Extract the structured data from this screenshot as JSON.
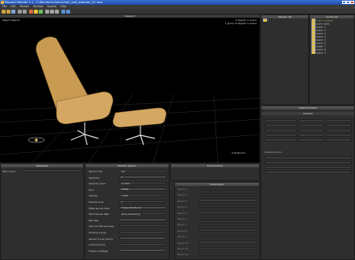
{
  "window": {
    "title": "Maxwell Render 1.1 - C:\\Renders\\chairs\\chair_and_ottoman_01.mxs"
  },
  "menu": [
    "File",
    "Edit",
    "Render",
    "Window",
    "Special",
    "Help"
  ],
  "viewport": {
    "label": "Object objects",
    "header": "Viewport",
    "info_line1": "0 objects in scene",
    "info_line2": "1 group of objects in scene",
    "fps": "0.00 fps 0%"
  },
  "objects_panel": {
    "header": "Objects list"
  },
  "scene_panel": {
    "header": "Scene list",
    "items": [
      "scene_camera",
      "scene_light",
      "object_1",
      "object_2",
      "object_3",
      "object_4",
      "object_5",
      "object_6",
      "object_7",
      "object_8",
      "object_9"
    ]
  },
  "object_params": {
    "header": "Object params",
    "section": "General",
    "section2": "Display options"
  },
  "attributes_panel": {
    "header": "Attributes",
    "item": "Main Scene"
  },
  "render_panel": {
    "header": "Render options",
    "rows": [
      {
        "label": "Render time",
        "value": "120"
      },
      {
        "label": "Sampling",
        "value": "1"
      },
      {
        "label": "Sampling level",
        "value": "15.0000"
      },
      {
        "label": "Burn",
        "value": "0.8000"
      },
      {
        "label": "Gamma",
        "value": "2.2000"
      },
      {
        "label": "Preview level",
        "value": "1"
      },
      {
        "label": "HDRL Render Path",
        "value": "image_default.png"
      },
      {
        "label": "HDLF Render Path",
        "value": "alpha_default.png"
      },
      {
        "label": "MXI Path",
        "value": ""
      },
      {
        "label": "Skip low Mat previews",
        "value": ""
      },
      {
        "label": "Preview priority",
        "value": ""
      },
      {
        "label": "Render in low priority",
        "value": ""
      },
      {
        "label": "Command line",
        "value": ""
      },
      {
        "label": "Enable multilight",
        "value": ""
      }
    ]
  },
  "environment_panel": {
    "header": "Environment"
  },
  "parameters_panel": {
    "header": "Parameters",
    "rows": [
      "Param 1",
      "Param 2",
      "Param 3",
      "Param 4",
      "Param 5",
      "Param 6",
      "Param 7",
      "Param 8",
      "Param 9",
      "Param 10",
      "Param 11",
      "Param 12"
    ]
  },
  "colors": {
    "accent": "#e8b23a",
    "panel": "#2e2e2e",
    "header": "#4a4a4a",
    "title": "#2a5bc2"
  }
}
